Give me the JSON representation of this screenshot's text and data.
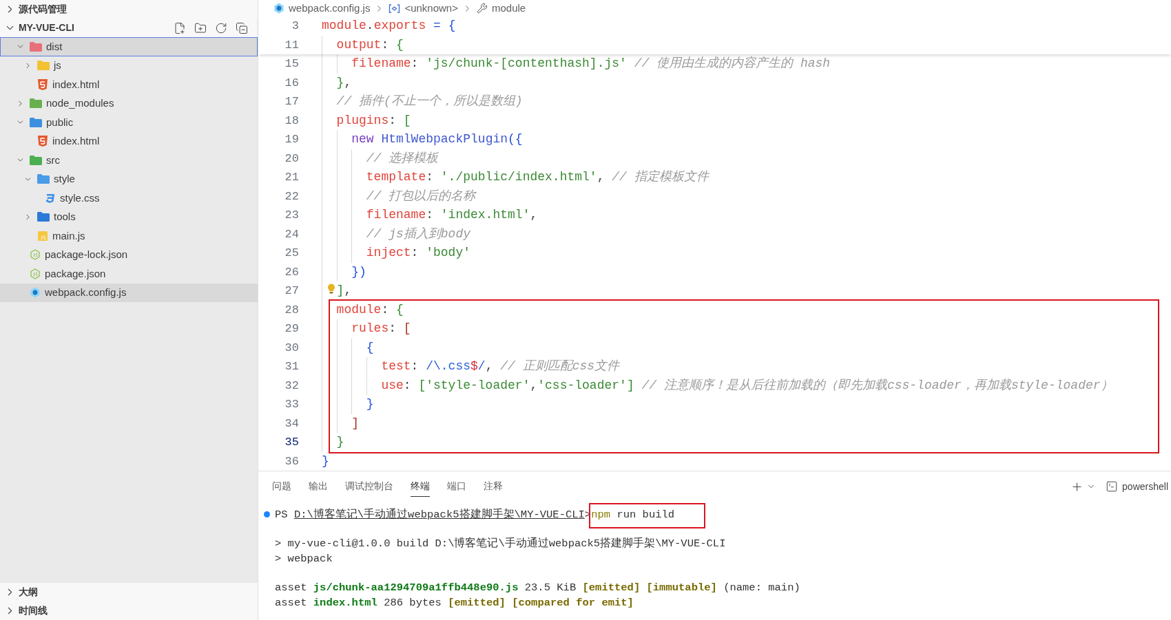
{
  "sidebar": {
    "top_section": {
      "title": "源代码管理",
      "expanded": false
    },
    "explorer": {
      "title": "MY-VUE-CLI",
      "expanded": true,
      "tree": [
        {
          "label": "dist",
          "kind": "folder-dist",
          "expanded": true,
          "selected": true,
          "focused": true,
          "children": [
            {
              "label": "js",
              "kind": "folder-js",
              "expanded": false,
              "selected": false,
              "focused": false
            },
            {
              "label": "index.html",
              "kind": "html",
              "selected": false,
              "focused": false
            }
          ]
        },
        {
          "label": "node_modules",
          "kind": "folder-node",
          "expanded": false,
          "selected": false,
          "focused": false
        },
        {
          "label": "public",
          "kind": "folder-public",
          "expanded": true,
          "selected": false,
          "focused": false,
          "children": [
            {
              "label": "index.html",
              "kind": "html",
              "selected": false,
              "focused": false
            }
          ]
        },
        {
          "label": "src",
          "kind": "folder-src",
          "expanded": true,
          "selected": false,
          "focused": false,
          "children": [
            {
              "label": "style",
              "kind": "folder-style",
              "expanded": true,
              "selected": false,
              "focused": false,
              "children": [
                {
                  "label": "style.css",
                  "kind": "css",
                  "selected": false,
                  "focused": false
                }
              ]
            },
            {
              "label": "tools",
              "kind": "folder-tools",
              "expanded": false,
              "selected": false,
              "focused": false
            },
            {
              "label": "main.js",
              "kind": "js",
              "selected": false,
              "focused": false
            }
          ]
        },
        {
          "label": "package-lock.json",
          "kind": "json",
          "selected": false,
          "focused": false
        },
        {
          "label": "package.json",
          "kind": "json",
          "selected": false,
          "focused": false
        },
        {
          "label": "webpack.config.js",
          "kind": "webpack",
          "selected": true,
          "focused": false
        }
      ]
    },
    "bottom_sections": [
      {
        "title": "大纲",
        "expanded": false
      },
      {
        "title": "时间线",
        "expanded": false
      }
    ]
  },
  "editor": {
    "breadcrumb": [
      {
        "kind": "file",
        "text": "webpack.config.js"
      },
      {
        "kind": "symbol",
        "text": "<unknown>"
      },
      {
        "kind": "property",
        "text": "module"
      }
    ],
    "lines": [
      {
        "number": "3",
        "sticky": true,
        "tokens": [
          {
            "kind": "key",
            "text": "module"
          },
          {
            "kind": "punct",
            "text": "."
          },
          {
            "kind": "key",
            "text": "exports"
          },
          {
            "kind": "op",
            "text": " = "
          },
          {
            "kind": "b1",
            "text": "{"
          }
        ],
        "children": [
          {
            "number": "11",
            "sticky": true,
            "tokens": [
              {
                "kind": "key",
                "text": "output"
              },
              {
                "kind": "punct",
                "text": ": "
              },
              {
                "kind": "b2",
                "text": "{"
              }
            ],
            "children": [
              {
                "number": "15",
                "tokens": [
                  {
                    "kind": "key",
                    "text": "filename"
                  },
                  {
                    "kind": "punct",
                    "text": ": "
                  },
                  {
                    "kind": "str",
                    "text": "'js/chunk-[contenthash].js'"
                  },
                  {
                    "kind": "comment",
                    "text": " // 使用由生成的内容产生的 hash"
                  }
                ]
              }
            ]
          },
          {
            "number": "16",
            "tokens": [
              {
                "kind": "b2",
                "text": "}"
              },
              {
                "kind": "punct",
                "text": ","
              }
            ]
          },
          {
            "number": "17",
            "tokens": [
              {
                "kind": "comment",
                "text": "// 插件(不止一个，所以是数组)"
              }
            ]
          },
          {
            "number": "18",
            "tokens": [
              {
                "kind": "key",
                "text": "plugins"
              },
              {
                "kind": "punct",
                "text": ": "
              },
              {
                "kind": "b2",
                "text": "["
              }
            ],
            "children": [
              {
                "number": "19",
                "tokens": [
                  {
                    "kind": "keyword",
                    "text": "new "
                  },
                  {
                    "kind": "class",
                    "text": "HtmlWebpackPlugin"
                  },
                  {
                    "kind": "b1",
                    "text": "({"
                  }
                ],
                "children": [
                  {
                    "number": "20",
                    "tokens": [
                      {
                        "kind": "comment",
                        "text": "// 选择模板"
                      }
                    ]
                  },
                  {
                    "number": "21",
                    "tokens": [
                      {
                        "kind": "key",
                        "text": "template"
                      },
                      {
                        "kind": "punct",
                        "text": ": "
                      },
                      {
                        "kind": "str",
                        "text": "'./public/index.html'"
                      },
                      {
                        "kind": "punct",
                        "text": ","
                      },
                      {
                        "kind": "comment",
                        "text": " // 指定模板文件"
                      }
                    ]
                  },
                  {
                    "number": "22",
                    "tokens": [
                      {
                        "kind": "comment",
                        "text": "// 打包以后的名称"
                      }
                    ]
                  },
                  {
                    "number": "23",
                    "tokens": [
                      {
                        "kind": "key",
                        "text": "filename"
                      },
                      {
                        "kind": "punct",
                        "text": ": "
                      },
                      {
                        "kind": "str",
                        "text": "'index.html'"
                      },
                      {
                        "kind": "punct",
                        "text": ","
                      }
                    ]
                  },
                  {
                    "number": "24",
                    "tokens": [
                      {
                        "kind": "comment",
                        "text": "// js插入到body"
                      }
                    ]
                  },
                  {
                    "number": "25",
                    "tokens": [
                      {
                        "kind": "key",
                        "text": "inject"
                      },
                      {
                        "kind": "punct",
                        "text": ": "
                      },
                      {
                        "kind": "str",
                        "text": "'body'"
                      }
                    ]
                  }
                ]
              },
              {
                "number": "26",
                "tokens": [
                  {
                    "kind": "b1",
                    "text": "})"
                  }
                ]
              }
            ]
          },
          {
            "number": "27",
            "lightbulb": true,
            "tokens": [
              {
                "kind": "b2",
                "text": "]"
              },
              {
                "kind": "punct",
                "text": ","
              }
            ]
          },
          {
            "number": "28",
            "boxed": true,
            "tokens": [
              {
                "kind": "key",
                "text": "module"
              },
              {
                "kind": "punct",
                "text": ": "
              },
              {
                "kind": "b2",
                "text": "{"
              }
            ],
            "children": [
              {
                "number": "29",
                "boxed": true,
                "tokens": [
                  {
                    "kind": "key",
                    "text": "rules"
                  },
                  {
                    "kind": "punct",
                    "text": ": "
                  },
                  {
                    "kind": "b3",
                    "text": "["
                  }
                ],
                "children": [
                  {
                    "number": "30",
                    "boxed": true,
                    "tokens": [
                      {
                        "kind": "b1",
                        "text": "{"
                      }
                    ],
                    "children": [
                      {
                        "number": "31",
                        "boxed": true,
                        "tokens": [
                          {
                            "kind": "key",
                            "text": "test"
                          },
                          {
                            "kind": "punct",
                            "text": ": "
                          },
                          {
                            "kind": "regex",
                            "text": "/\\.css"
                          },
                          {
                            "kind": "anchor",
                            "text": "$"
                          },
                          {
                            "kind": "regex",
                            "text": "/"
                          },
                          {
                            "kind": "punct",
                            "text": ","
                          },
                          {
                            "kind": "comment",
                            "text": " // 正则匹配css文件"
                          }
                        ]
                      },
                      {
                        "number": "32",
                        "boxed": true,
                        "tokens": [
                          {
                            "kind": "key",
                            "text": "use"
                          },
                          {
                            "kind": "punct",
                            "text": ": "
                          },
                          {
                            "kind": "b2",
                            "text": "["
                          },
                          {
                            "kind": "str",
                            "text": "'style-loader'"
                          },
                          {
                            "kind": "punct",
                            "text": ","
                          },
                          {
                            "kind": "str",
                            "text": "'css-loader'"
                          },
                          {
                            "kind": "b2",
                            "text": "]"
                          },
                          {
                            "kind": "comment",
                            "text": " // 注意顺序！是从后往前加载的（即先加载css-loader，再加载style-loader）"
                          }
                        ]
                      }
                    ]
                  },
                  {
                    "number": "33",
                    "boxed": true,
                    "tokens": [
                      {
                        "kind": "b1",
                        "text": "}"
                      }
                    ]
                  }
                ]
              },
              {
                "number": "34",
                "boxed": true,
                "tokens": [
                  {
                    "kind": "b3",
                    "text": "]"
                  }
                ]
              }
            ]
          },
          {
            "number": "35",
            "current": true,
            "boxed": true,
            "tokens": [
              {
                "kind": "b2",
                "text": "}"
              }
            ]
          }
        ]
      },
      {
        "number": "36",
        "tokens": [
          {
            "kind": "b1",
            "text": "}"
          }
        ]
      }
    ]
  },
  "panel": {
    "tabs": [
      {
        "label": "问题",
        "selected": false
      },
      {
        "label": "输出",
        "selected": false
      },
      {
        "label": "调试控制台",
        "selected": false
      },
      {
        "label": "终端",
        "selected": true
      },
      {
        "label": "端口",
        "selected": false
      },
      {
        "label": "注释",
        "selected": false
      }
    ],
    "shell": "powershell",
    "lines": [
      {
        "marker": true,
        "segments": [
          {
            "kind": "text",
            "text": "PS "
          },
          {
            "kind": "path",
            "text": "D:\\博客笔记\\手动通过webpack5搭建脚手架\\MY-VUE-CLI"
          },
          {
            "kind": "text",
            "text": ">"
          },
          {
            "kind": "command",
            "program": "npm",
            "args": "run build",
            "boxed": true
          }
        ]
      },
      {
        "spaced": true,
        "segments": [
          {
            "kind": "text",
            "text": "> my-vue-cli@1.0.0 build D:\\博客笔记\\手动通过webpack5搭建脚手架\\MY-VUE-CLI"
          }
        ]
      },
      {
        "segments": [
          {
            "kind": "text",
            "text": "> webpack"
          }
        ]
      },
      {
        "spaced": true,
        "segments": [
          {
            "kind": "text",
            "text": "asset "
          },
          {
            "kind": "file",
            "text": "js/chunk-aa1294709a1ffb448e90.js"
          },
          {
            "kind": "text",
            "text": " 23.5 KiB "
          },
          {
            "kind": "flag",
            "text": "[emitted]"
          },
          {
            "kind": "flag",
            "text": "[immutable]"
          },
          {
            "kind": "text",
            "text": " (name: main)"
          }
        ]
      },
      {
        "segments": [
          {
            "kind": "text",
            "text": "asset "
          },
          {
            "kind": "file",
            "text": "index.html"
          },
          {
            "kind": "text",
            "text": " 286 bytes "
          },
          {
            "kind": "flag",
            "text": "[emitted]"
          },
          {
            "kind": "flag",
            "text": "[compared for emit]"
          }
        ]
      }
    ]
  }
}
